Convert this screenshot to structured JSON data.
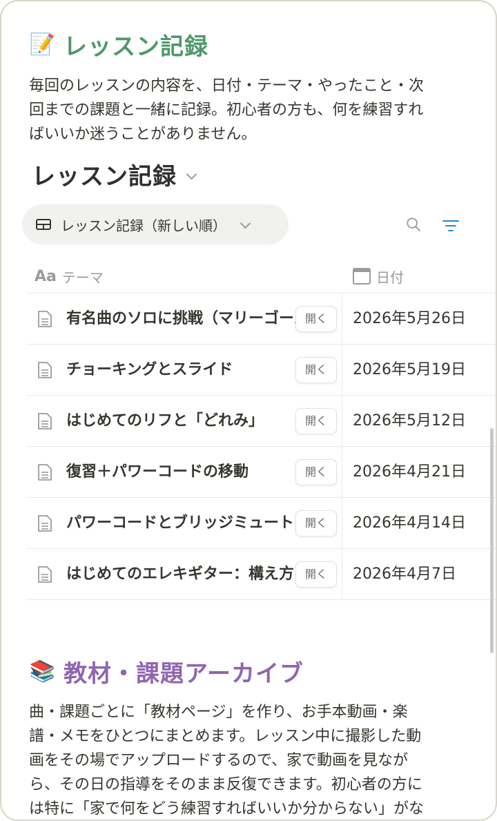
{
  "section1": {
    "emoji": "📝",
    "heading": "レッスン記録",
    "heading_color": "#4f9768",
    "description_lines": [
      "毎回のレッスンの内容を、日付・テーマ・やったこと・次",
      "回までの課題と一緒に記録。初心者の方も、何を練習すれ",
      "ばいいか迷うことがありません。"
    ]
  },
  "database": {
    "title": "レッスン記録",
    "view_label": "レッスン記録（新しい順）",
    "icons": {
      "view": "table-icon",
      "search": "search-icon",
      "filter": "filter-icon"
    },
    "filter_color": "#2383e2",
    "columns": {
      "title": "テーマ",
      "title_icon": "Aa",
      "date": "日付"
    },
    "open_label": "開く",
    "rows": [
      {
        "title": "有名曲のソロに挑戦（マリーゴールド）",
        "date": "2026年5月26日"
      },
      {
        "title": "チョーキングとスライド",
        "date": "2026年5月19日"
      },
      {
        "title": "はじめてのリフと「どれみ」",
        "date": "2026年5月12日"
      },
      {
        "title": "復習＋パワーコードの移動",
        "date": "2026年4月21日"
      },
      {
        "title": "パワーコードとブリッジミュート",
        "date": "2026年4月14日"
      },
      {
        "title": "はじめてのエレキギター：構え方と弦",
        "date": "2026年4月7日"
      }
    ]
  },
  "section2": {
    "emoji": "📚",
    "heading": "教材・課題アーカイブ",
    "heading_color": "#9065b0",
    "description_lines": [
      "曲・課題ごとに「教材ページ」を作り、お手本動画・楽",
      "譜・メモをひとつにまとめます。レッスン中に撮影した動",
      "画をその場でアップロードするので、家で動画を見なが",
      "ら、その日の指導をそのまま反復できます。初心者の方に",
      "は特に「家で何をどう練習すればいいか分からない」がな"
    ]
  }
}
